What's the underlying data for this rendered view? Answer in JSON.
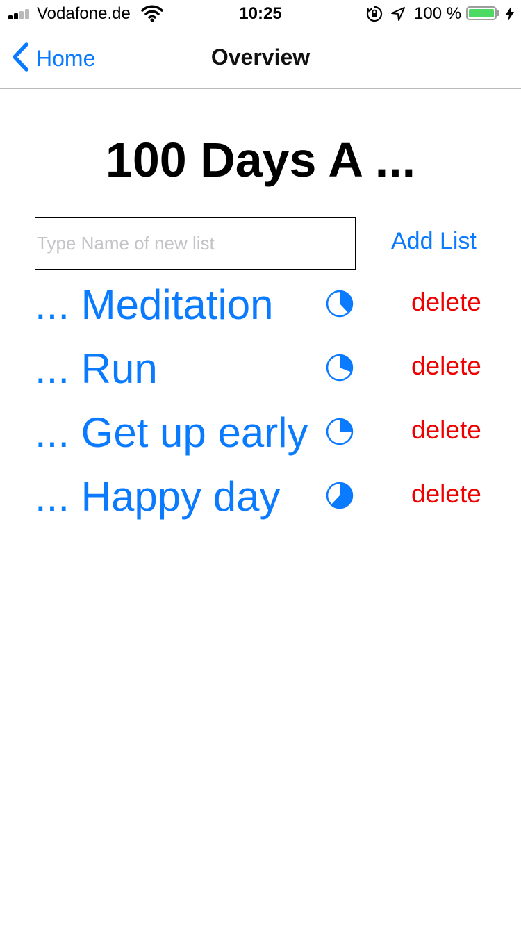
{
  "status_bar": {
    "carrier": "Vodafone.de",
    "time": "10:25",
    "battery_percent": "100 %",
    "signal_bars_active": 2,
    "signal_bars_total": 4,
    "battery_level": 1.0,
    "battery_color": "#4cd964"
  },
  "nav": {
    "back_label": "Home",
    "title": "Overview",
    "back_icon": "chevron-left-icon"
  },
  "main": {
    "title": "100 Days A ...",
    "input_placeholder": "Type Name of new list",
    "input_value": "",
    "add_list_label": "Add List"
  },
  "lists": [
    {
      "name": "... Meditation",
      "progress": 0.38,
      "delete_label": "delete"
    },
    {
      "name": "... Run",
      "progress": 0.31,
      "delete_label": "delete"
    },
    {
      "name": "... Get up early",
      "progress": 0.25,
      "delete_label": "delete"
    },
    {
      "name": "... Happy day",
      "progress": 0.62,
      "delete_label": "delete"
    }
  ],
  "colors": {
    "accent": "#0a7aff",
    "destructive": "#ee0000",
    "separator": "#bcbcbc"
  }
}
